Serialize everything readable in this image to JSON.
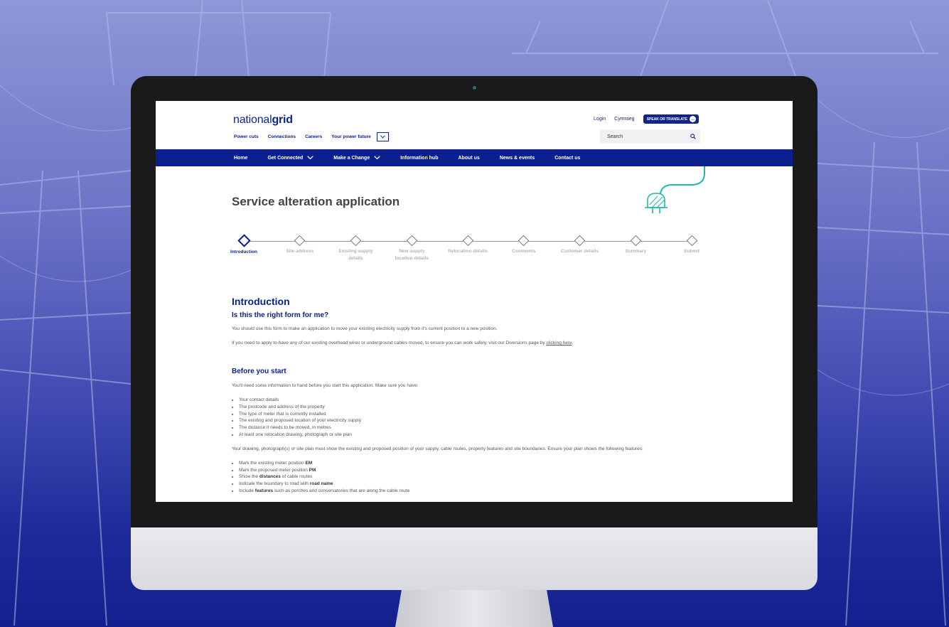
{
  "colors": {
    "brand_navy": "#0b1f8f",
    "accent_teal": "#1fb8a5",
    "background_gradient_top": "#8f97d8",
    "background_gradient_bottom": "#14208e"
  },
  "header": {
    "logo_light": "national",
    "logo_bold": "grid",
    "subnav": [
      "Power cuts",
      "Connections",
      "Careers",
      "Your power future"
    ],
    "subnav_expand_icon": "chevron-down-icon",
    "login": "Login",
    "language": "Cymraeg",
    "speak_translate": "SPEAK OR TRANSLATE",
    "search_placeholder": "Search"
  },
  "mainnav": [
    {
      "label": "Home",
      "dropdown": false
    },
    {
      "label": "Get Connected",
      "dropdown": true
    },
    {
      "label": "Make a Change",
      "dropdown": true
    },
    {
      "label": "Information hub",
      "dropdown": false
    },
    {
      "label": "About us",
      "dropdown": false
    },
    {
      "label": "News & events",
      "dropdown": false
    },
    {
      "label": "Contact us",
      "dropdown": false
    }
  ],
  "page": {
    "title": "Service alteration application",
    "steps": [
      {
        "label": "Introduction",
        "active": true
      },
      {
        "label": "Site address",
        "active": false
      },
      {
        "label": "Existing supply details",
        "active": false
      },
      {
        "label": "New supply location details",
        "active": false
      },
      {
        "label": "Relocation details",
        "active": false
      },
      {
        "label": "Comments",
        "active": false
      },
      {
        "label": "Customer details",
        "active": false
      },
      {
        "label": "Summary",
        "active": false
      },
      {
        "label": "Submit",
        "active": false
      }
    ],
    "intro_heading": "Introduction",
    "right_form_heading": "Is this the right form for me?",
    "intro_p1": "You should use this form to make an application to move your existing electricity supply from it's current position to a new position.",
    "intro_p2_before": "If you need to apply to have any of our existing overhead wires or underground cables moved, to ensure you can work safely, visit our Diversions page by ",
    "intro_p2_link": "clicking here",
    "intro_p2_after": ".",
    "before_heading": "Before you start",
    "before_p": "You'll need some information to hand before you start this application. Make sure you have:",
    "before_list": [
      "Your contact details",
      "The postcode and address of the property",
      "The type of meter that is currently installed",
      "The existing and proposed location of your electricity supply",
      "The distance it needs to be moved, in metres",
      "At least one relocation drawing, photograph or site plan"
    ],
    "drawing_p": "Your drawing, photograph(s) or site plan must show the existing and proposed position of your supply, cable routes, property features and site boundaries. Ensure your plan shows the following features:",
    "features": [
      {
        "before": "Mark the existing meter position ",
        "bold": "EM",
        "after": ""
      },
      {
        "before": "Mark the proposed meter position ",
        "bold": "PM",
        "after": ""
      },
      {
        "before": "Show the ",
        "bold": "distances",
        "after": " of cable routes"
      },
      {
        "before": "Indicate the boundary to road with ",
        "bold": "road name",
        "after": ""
      },
      {
        "before": "Include ",
        "bold": "features",
        "after": " such as porches and conservatories that are along the cable route"
      }
    ]
  }
}
